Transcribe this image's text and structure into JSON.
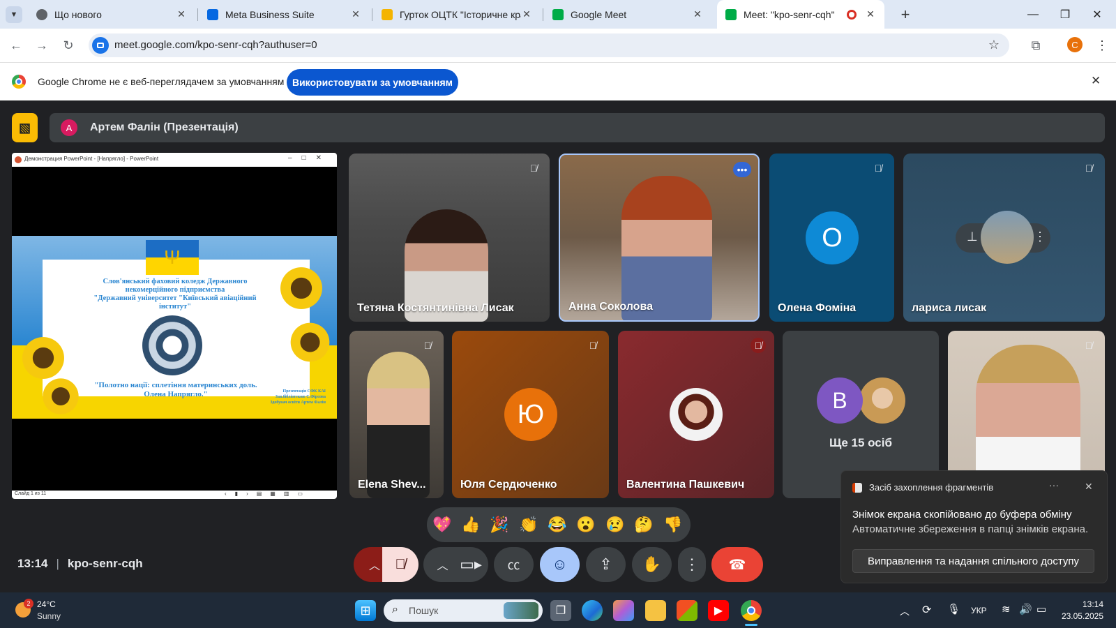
{
  "tabs": [
    {
      "title": "Що нового",
      "icon": "chrome-icon",
      "color": "#5f6368"
    },
    {
      "title": "Meta Business Suite",
      "icon": "meta-icon",
      "color": "#0668e1"
    },
    {
      "title": "Гурток ОЦТК \"Історичне краєз",
      "icon": "slides-icon",
      "color": "#f4b400"
    },
    {
      "title": "Google Meet",
      "icon": "meet-icon",
      "color": "#00ac47"
    },
    {
      "title": "Meet: \"kpo-senr-cqh\"",
      "icon": "meet-icon",
      "color": "#00ac47"
    }
  ],
  "address": {
    "url": "meet.google.com/kpo-senr-cqh?authuser=0"
  },
  "profile_initial": "C",
  "infobar": {
    "message": "Google Chrome не є веб-переглядачем за умовчанням",
    "button": "Використовувати за умовчанням"
  },
  "presenter": {
    "initial": "А",
    "label": "Артем Фалін (Презентація)"
  },
  "presentation": {
    "window_title": "Демонстрация PowerPoint - [Напрягло] - PowerPoint",
    "slide_lines": [
      "Слов'янський фаховий коледж Державного",
      "некомерційного підприємства",
      "\"Державний університет \"Київський авіаційний",
      "інститут\""
    ],
    "slide_title_1": "\"Полотно нації: сплетіння материнських доль.",
    "slide_title_2": "Олена Напрягло.\"",
    "credits": [
      "Презентація СФК КАІ",
      "Зав.бібліотекою С.Фірсова",
      "Здобувач освіти Артем Фалін"
    ],
    "status": "Слайд 1 из 11"
  },
  "participants": {
    "p1": "Тетяна Костянтинівна Лисак",
    "p2": "Анна Соколова",
    "p3": {
      "name": "Олена Фоміна",
      "initial": "О"
    },
    "p4": "лариса лисак",
    "p5": "Elena Shev...",
    "p6": {
      "name": "Юля Сердюченко",
      "initial": "Ю"
    },
    "p7": "Валентина Пашкевич",
    "more": {
      "label": "Ще 15 осіб",
      "initial": "B"
    }
  },
  "reactions": [
    "💖",
    "👍",
    "🎉",
    "👏",
    "😂",
    "😮",
    "😢",
    "🤔",
    "👎"
  ],
  "meeting": {
    "time": "13:14",
    "code": "kpo-senr-cqh"
  },
  "toast": {
    "app": "Засіб захоплення фрагментів",
    "line1": "Знімок екрана скопійовано до буфера обміну",
    "line2": "Автоматичне збереження в папці знімків екрана.",
    "button": "Виправлення та надання спільного доступу"
  },
  "taskbar": {
    "weather_badge": "2",
    "temp": "24°C",
    "condition": "Sunny",
    "search": "Пошук",
    "lang": "УКР",
    "time": "13:14",
    "date": "23.05.2025"
  },
  "colors": {
    "accent": "#0b57d0",
    "end_call": "#ea4335",
    "mute_bg": "#f9dedc",
    "raise_bg": "#a8c7fa"
  }
}
